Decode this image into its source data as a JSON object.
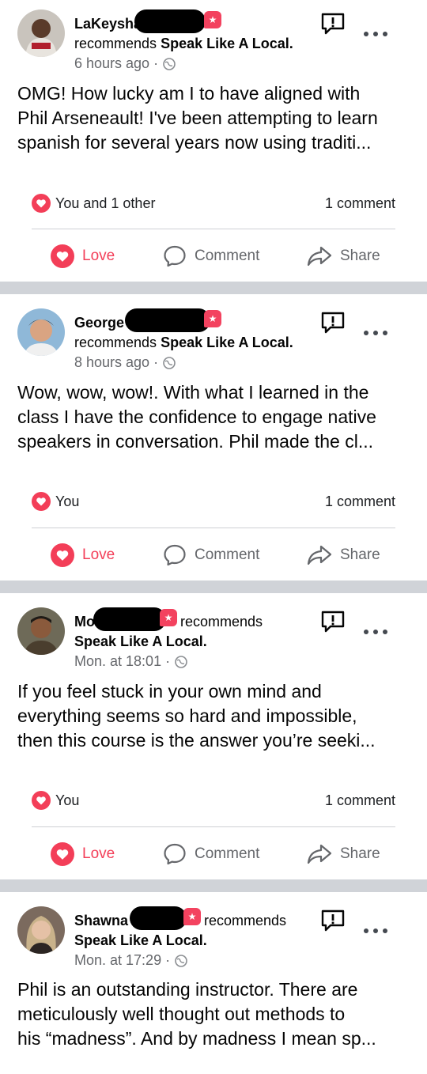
{
  "posts": [
    {
      "name": "LaKeysha",
      "name_suffix_word": "",
      "recommends_line": "recommends",
      "page": "Speak Like A Local.",
      "time": "6 hours ago",
      "body": [
        "OMG! How lucky am I to have aligned with",
        "Phil Arseneault! I've been attempting to learn",
        "spanish for several years now using traditi..."
      ],
      "reactions": "You and 1 other",
      "comments": "1 comment"
    },
    {
      "name": "George",
      "name_suffix_word": "",
      "recommends_line": "recommends",
      "page": "Speak Like A Local.",
      "time": "8 hours ago",
      "body": [
        "Wow, wow, wow!.  With what I learned in the",
        "class I have the confidence to engage native",
        "speakers in conversation.  Phil made the cl..."
      ],
      "reactions": "You",
      "comments": "1 comment"
    },
    {
      "name": "Mo",
      "name_suffix_word": "recommends",
      "page": "Speak Like A Local.",
      "time": "Mon. at 18:01",
      "body": [
        "If you feel stuck in your own mind and",
        "everything seems so hard and impossible,",
        "then this course is the answer you’re seeki..."
      ],
      "reactions": "You",
      "comments": "1 comment"
    },
    {
      "name": "Shawna",
      "name_suffix_word": "recommends",
      "page": "Speak Like A Local.",
      "time": "Mon. at 17:29",
      "body": [
        "Phil is an outstanding instructor. There are",
        "meticulously well thought out methods to",
        "his “madness”. And by madness I mean sp..."
      ]
    }
  ],
  "actions": {
    "love": "Love",
    "comment": "Comment",
    "share": "Share"
  },
  "icons": {
    "report": "report-flag-icon",
    "more": "more-options-icon",
    "globe": "globe-icon",
    "heart": "heart-reaction-icon",
    "comment": "comment-bubble-icon",
    "share": "share-arrow-icon",
    "badge": "recommendation-badge-icon"
  },
  "colors": {
    "love": "#f33e58",
    "muted": "#65676b",
    "separator": "#d0d3d8",
    "badge": "#f3425f"
  }
}
